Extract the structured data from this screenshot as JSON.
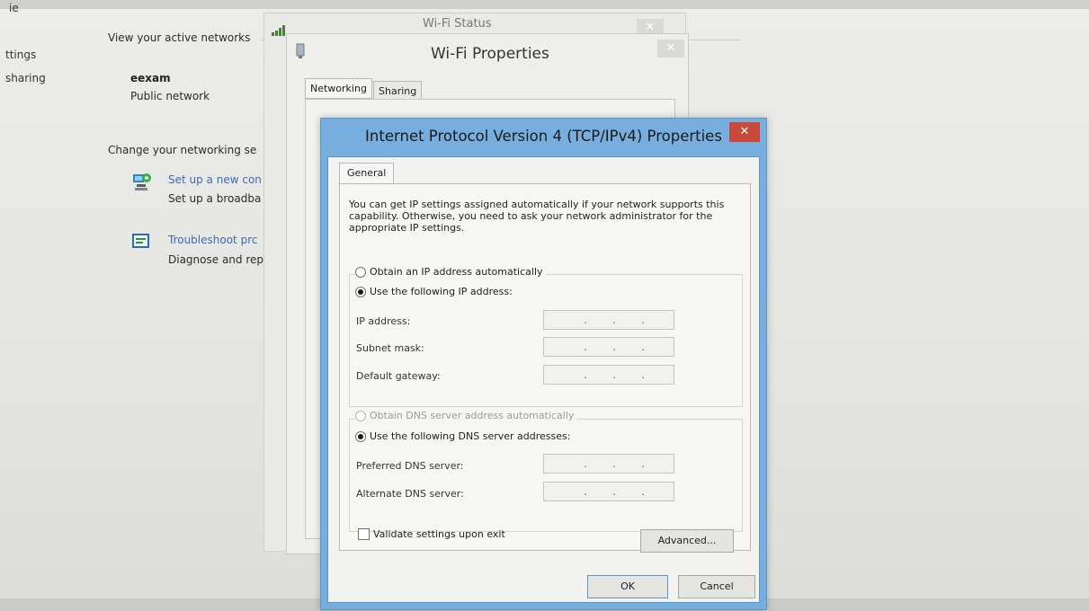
{
  "left_pane": {
    "item0": "ie",
    "item1": "ttings",
    "item2": "sharing"
  },
  "network_center": {
    "view_active": "View your active networks",
    "network_name": "eexam",
    "network_type": "Public network",
    "change_settings": "Change your networking se",
    "setup_link": "Set up a new con",
    "setup_desc": "Set up a broadba",
    "troubleshoot_link": "Troubleshoot prc",
    "troubleshoot_desc": "Diagnose and rep"
  },
  "wifi_status": {
    "title": "Wi-Fi Status"
  },
  "wifi_properties": {
    "title": "Wi-Fi Properties",
    "close": "✕",
    "tabs": [
      "Networking",
      "Sharing"
    ]
  },
  "ipv4_dialog": {
    "title": "Internet Protocol Version 4 (TCP/IPv4) Properties",
    "close": "✕",
    "tab": "General",
    "description": "You can get IP settings assigned automatically if your network supports this capability. Otherwise, you need to ask your network administrator for the appropriate IP settings.",
    "obtain_ip_auto": "Obtain an IP address automatically",
    "use_following_ip": "Use the following IP address:",
    "ip_address_label": "IP address:",
    "subnet_mask_label": "Subnet mask:",
    "default_gateway_label": "Default gateway:",
    "obtain_dns_auto": "Obtain DNS server address automatically",
    "use_following_dns": "Use the following DNS server addresses:",
    "preferred_dns_label": "Preferred DNS server:",
    "alternate_dns_label": "Alternate DNS server:",
    "field_dot": ".",
    "validate_label": "Validate settings upon exit",
    "advanced_button": "Advanced...",
    "ok_button": "OK",
    "cancel_button": "Cancel",
    "ip_mode": "manual",
    "dns_mode": "manual",
    "validate_checked": false
  }
}
